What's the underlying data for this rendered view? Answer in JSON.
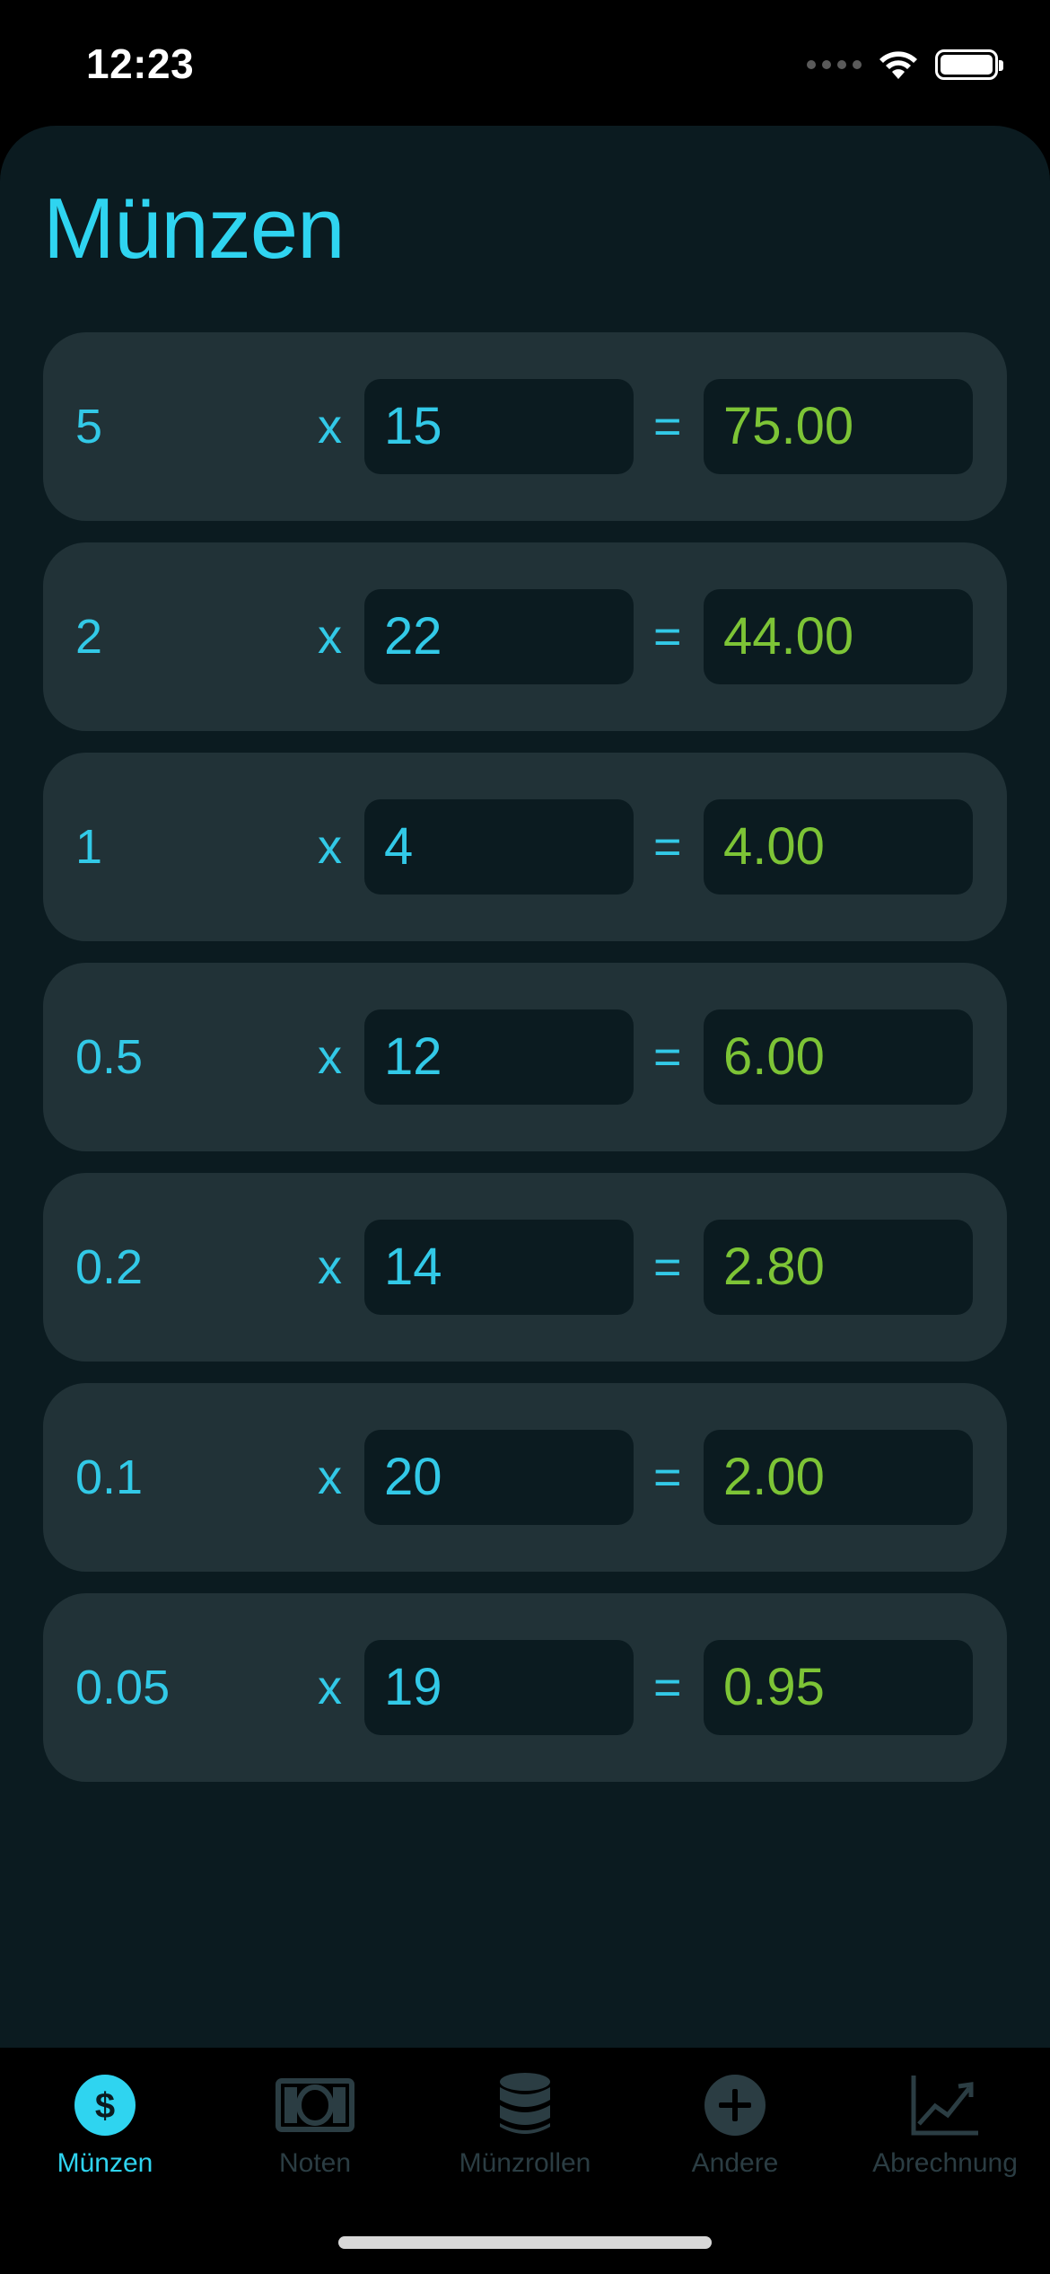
{
  "status": {
    "time": "12:23"
  },
  "page_title": "Münzen",
  "rows": [
    {
      "denomination": "5",
      "op": "x",
      "count": "15",
      "eq": "=",
      "total": "75.00"
    },
    {
      "denomination": "2",
      "op": "x",
      "count": "22",
      "eq": "=",
      "total": "44.00"
    },
    {
      "denomination": "1",
      "op": "x",
      "count": "4",
      "eq": "=",
      "total": "4.00"
    },
    {
      "denomination": "0.5",
      "op": "x",
      "count": "12",
      "eq": "=",
      "total": "6.00"
    },
    {
      "denomination": "0.2",
      "op": "x",
      "count": "14",
      "eq": "=",
      "total": "2.80"
    },
    {
      "denomination": "0.1",
      "op": "x",
      "count": "20",
      "eq": "=",
      "total": "2.00"
    },
    {
      "denomination": "0.05",
      "op": "x",
      "count": "19",
      "eq": "=",
      "total": "0.95"
    }
  ],
  "tabs": [
    {
      "label": "Münzen",
      "icon": "dollar-circle-icon",
      "active": true
    },
    {
      "label": "Noten",
      "icon": "banknote-icon",
      "active": false
    },
    {
      "label": "Münzrollen",
      "icon": "coin-stack-icon",
      "active": false
    },
    {
      "label": "Andere",
      "icon": "plus-circle-icon",
      "active": false
    },
    {
      "label": "Abrechnung",
      "icon": "chart-icon",
      "active": false
    }
  ],
  "colors": {
    "accent": "#2fd4f0",
    "result_green": "#7dc436",
    "background": "#0b1b20",
    "row_background": "#213237",
    "inactive_tab": "#2b3d43"
  }
}
